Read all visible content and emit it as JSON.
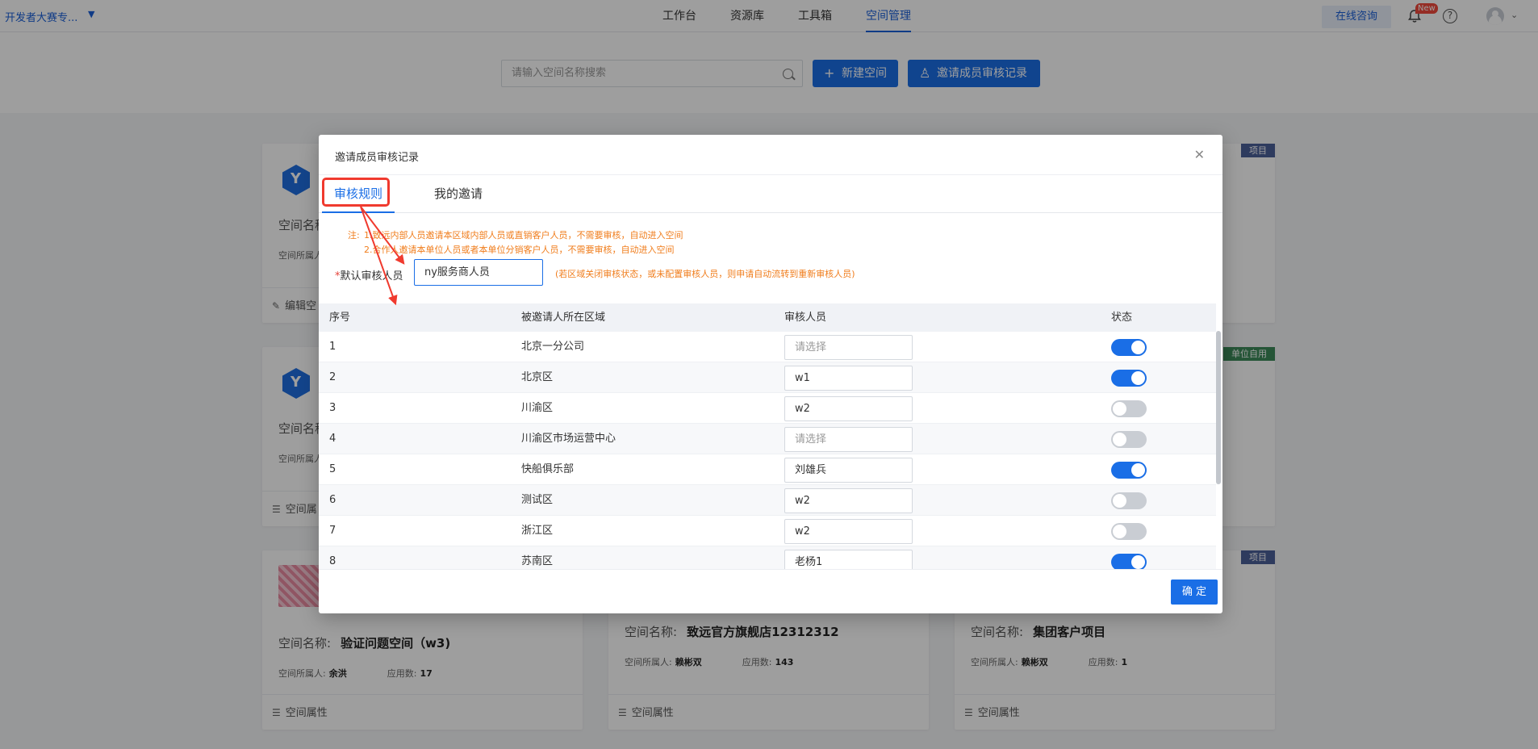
{
  "topbar": {
    "org_name": "开发者大赛专...",
    "nav": [
      "工作台",
      "资源库",
      "工具箱",
      "空间管理"
    ],
    "consult": "在线咨询",
    "new_badge": "New"
  },
  "search": {
    "placeholder": "请输入空间名称搜索",
    "new_space": "新建空间",
    "invite_record": "邀请成员审核记录"
  },
  "cards": {
    "tag_project": "项目",
    "tag_unit": "单位自用",
    "title_label": "空间名称",
    "owner_label": "空间所属人",
    "edit": "编辑空",
    "prop_short": "空间属",
    "space_prop": "空间属性",
    "card3": {
      "title_label": "空间名称:",
      "title": "验证问题空间（w3)",
      "owner_label": "空间所属人:",
      "owner": "余洪",
      "apps_label": "应用数:",
      "apps": "17"
    },
    "card4": {
      "title_label": "空间名称:",
      "title": "致远官方旗舰店12312312",
      "owner_label": "空间所属人:",
      "owner": "赖彬双",
      "apps_label": "应用数:",
      "apps": "143"
    },
    "card5": {
      "title_label": "空间名称:",
      "title": "集团客户项目",
      "owner_label": "空间所属人:",
      "owner": "赖彬双",
      "apps_label": "应用数:",
      "apps": "1"
    }
  },
  "modal": {
    "title": "邀请成员审核记录",
    "tabs": [
      "审核规则",
      "我的邀请"
    ],
    "note_label": "注:",
    "note_1": "1.致远内部人员邀请本区域内部人员或直销客户人员，不需要审核，自动进入空间",
    "note_2": "2.合作人邀请本单位人员或者本单位分销客户人员，不需要审核，自动进入空间",
    "default_required": "*",
    "default_label": "默认审核人员",
    "default_value": "ny服务商人员",
    "default_hint": "(若区域关闭审核状态，或未配置审核人员，则申请自动流转到重新审核人员)",
    "columns": [
      "序号",
      "被邀请人所在区域",
      "审核人员",
      "状态"
    ],
    "rows": [
      {
        "no": "1",
        "region": "北京一分公司",
        "reviewer": "",
        "reviewer_placeholder": "请选择",
        "enabled": true
      },
      {
        "no": "2",
        "region": "北京区",
        "reviewer": "w1",
        "reviewer_placeholder": "",
        "enabled": true
      },
      {
        "no": "3",
        "region": "川渝区",
        "reviewer": "w2",
        "reviewer_placeholder": "",
        "enabled": false
      },
      {
        "no": "4",
        "region": "川渝区市场运营中心",
        "reviewer": "",
        "reviewer_placeholder": "请选择",
        "enabled": false
      },
      {
        "no": "5",
        "region": "快船俱乐部",
        "reviewer": "刘雄兵",
        "reviewer_placeholder": "",
        "enabled": true
      },
      {
        "no": "6",
        "region": "测试区",
        "reviewer": "w2",
        "reviewer_placeholder": "",
        "enabled": false
      },
      {
        "no": "7",
        "region": "浙江区",
        "reviewer": "w2",
        "reviewer_placeholder": "",
        "enabled": false
      },
      {
        "no": "8",
        "region": "苏南区",
        "reviewer": "老杨1",
        "reviewer_placeholder": "",
        "enabled": true
      }
    ],
    "confirm": "确 定"
  },
  "colors": {
    "accent": "#1a6ee6",
    "warning": "#f07d1c",
    "annotation": "#f03a2e"
  }
}
